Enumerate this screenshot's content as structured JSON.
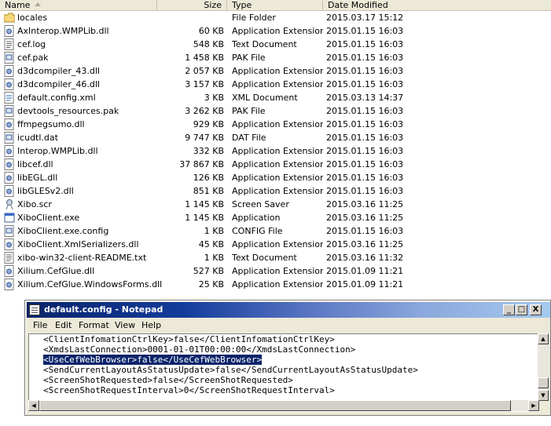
{
  "columns": {
    "name": "Name",
    "size": "Size",
    "type": "Type",
    "date": "Date Modified"
  },
  "files": [
    {
      "name": "locales",
      "size": "",
      "type": "File Folder",
      "date": "2015.03.17 15:12",
      "icon": "folder-icon"
    },
    {
      "name": "AxInterop.WMPLib.dll",
      "size": "60 KB",
      "type": "Application Extension",
      "date": "2015.01.15 16:03",
      "icon": "dll-icon"
    },
    {
      "name": "cef.log",
      "size": "548 KB",
      "type": "Text Document",
      "date": "2015.01.15 16:03",
      "icon": "text-file-icon"
    },
    {
      "name": "cef.pak",
      "size": "1 458 KB",
      "type": "PAK File",
      "date": "2015.01.15 16:03",
      "icon": "generic-file-icon"
    },
    {
      "name": "d3dcompiler_43.dll",
      "size": "2 057 KB",
      "type": "Application Extension",
      "date": "2015.01.15 16:03",
      "icon": "dll-icon"
    },
    {
      "name": "d3dcompiler_46.dll",
      "size": "3 157 KB",
      "type": "Application Extension",
      "date": "2015.01.15 16:03",
      "icon": "dll-icon"
    },
    {
      "name": "default.config.xml",
      "size": "3 KB",
      "type": "XML Document",
      "date": "2015.03.13 14:37",
      "icon": "xml-file-icon"
    },
    {
      "name": "devtools_resources.pak",
      "size": "3 262 KB",
      "type": "PAK File",
      "date": "2015.01.15 16:03",
      "icon": "generic-file-icon"
    },
    {
      "name": "ffmpegsumo.dll",
      "size": "929 KB",
      "type": "Application Extension",
      "date": "2015.01.15 16:03",
      "icon": "dll-icon"
    },
    {
      "name": "icudtl.dat",
      "size": "9 747 KB",
      "type": "DAT File",
      "date": "2015.01.15 16:03",
      "icon": "generic-file-icon"
    },
    {
      "name": "Interop.WMPLib.dll",
      "size": "332 KB",
      "type": "Application Extension",
      "date": "2015.01.15 16:03",
      "icon": "dll-icon"
    },
    {
      "name": "libcef.dll",
      "size": "37 867 KB",
      "type": "Application Extension",
      "date": "2015.01.15 16:03",
      "icon": "dll-icon"
    },
    {
      "name": "libEGL.dll",
      "size": "126 KB",
      "type": "Application Extension",
      "date": "2015.01.15 16:03",
      "icon": "dll-icon"
    },
    {
      "name": "libGLESv2.dll",
      "size": "851 KB",
      "type": "Application Extension",
      "date": "2015.01.15 16:03",
      "icon": "dll-icon"
    },
    {
      "name": "Xibo.scr",
      "size": "1 145 KB",
      "type": "Screen Saver",
      "date": "2015.03.16 11:25",
      "icon": "screensaver-icon"
    },
    {
      "name": "XiboClient.exe",
      "size": "1 145 KB",
      "type": "Application",
      "date": "2015.03.16 11:25",
      "icon": "application-icon"
    },
    {
      "name": "XiboClient.exe.config",
      "size": "1 KB",
      "type": "CONFIG File",
      "date": "2015.01.15 16:03",
      "icon": "generic-file-icon"
    },
    {
      "name": "XiboClient.XmlSerializers.dll",
      "size": "45 KB",
      "type": "Application Extension",
      "date": "2015.03.16 11:25",
      "icon": "dll-icon"
    },
    {
      "name": "xibo-win32-client-README.txt",
      "size": "1 KB",
      "type": "Text Document",
      "date": "2015.03.16 11:32",
      "icon": "text-file-icon"
    },
    {
      "name": "Xilium.CefGlue.dll",
      "size": "527 KB",
      "type": "Application Extension",
      "date": "2015.01.09 11:21",
      "icon": "dll-icon"
    },
    {
      "name": "Xilium.CefGlue.WindowsForms.dll",
      "size": "25 KB",
      "type": "Application Extension",
      "date": "2015.01.09 11:21",
      "icon": "dll-icon"
    }
  ],
  "notepad": {
    "title": "default.config - Notepad",
    "menu": [
      "File",
      "Edit",
      "Format",
      "View",
      "Help"
    ],
    "buttons": {
      "minimize": "_",
      "maximize": "□",
      "close": "X"
    },
    "lines": [
      "<ClientInfomationCtrlKey>false</ClientInfomationCtrlKey>",
      "<XmdsLastConnection>0001-01-01T00:00:00</XmdsLastConnection>",
      "<UseCefWebBrowser>false</UseCefWebBrowser>",
      "<SendCurrentLayoutAsStatusUpdate>false</SendCurrentLayoutAsStatusUpdate>",
      "<ScreenShotRequested>false</ScreenShotRequested>",
      "<ScreenShotRequestInterval>0</ScreenShotRequestInterval>"
    ],
    "selected_line_index": 2
  },
  "colors": {
    "titlebar_start": "#0a246a",
    "titlebar_end": "#a6caf0",
    "selection": "#0a246a",
    "chrome": "#ece9d8"
  }
}
